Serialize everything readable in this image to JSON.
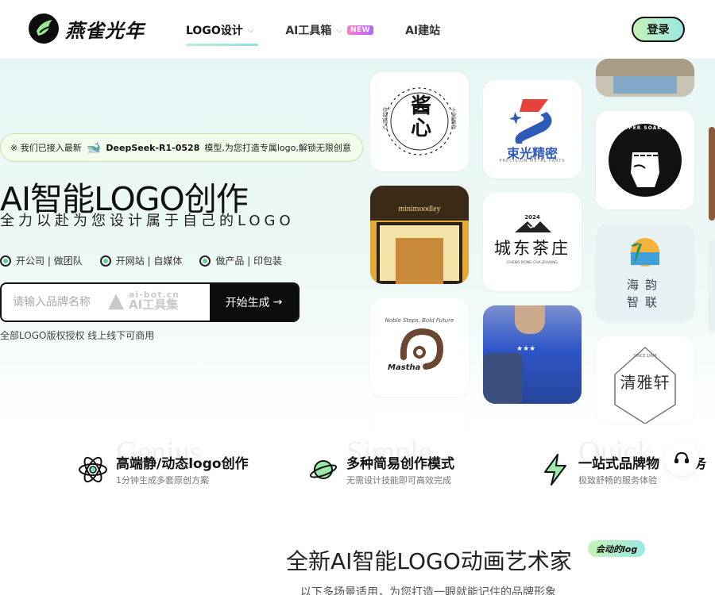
{
  "brand": {
    "name": "燕雀光年"
  },
  "nav": {
    "items": [
      {
        "label": "LOGO设计",
        "active": true,
        "has_dropdown": true
      },
      {
        "label": "AI工具箱",
        "has_dropdown": true,
        "badge": "NEW"
      },
      {
        "label": "AI建站"
      }
    ],
    "login_label": "登录"
  },
  "hero": {
    "notice": {
      "prefix": "※ 我们已接入最新",
      "model": "DeepSeek-R1-0528",
      "suffix": "模型,为您打造专属logo,解锁无限创意"
    },
    "title": "AI智能LOGO创作",
    "subtitle": "全力以赴为您设计属于自己的LOGO",
    "features": [
      "开公司 | 做团队",
      "开网站 | 自媒体",
      "做产品 | 印包装"
    ],
    "search": {
      "placeholder": "请输入品牌名称",
      "button_label": "开始生成",
      "button_arrow": "→"
    },
    "watermark": {
      "url": "ai-bot.cn",
      "name": "AI工具集"
    },
    "copyright": "全部LOGO版权授权 线上线下可商用"
  },
  "logo_cards": [
    {
      "name": "酱心",
      "side_left": "佳味精心",
      "side_right": "十里飘香"
    },
    {
      "name": "束光精密",
      "tagline": "PRECISION METAL PARTS"
    },
    {
      "name": "SUPER SOAKER"
    },
    {
      "name": "minimoodley"
    },
    {
      "name": "城东茶庄",
      "year": "2024",
      "tagline": "CHENG DONG CHA ZHUANG"
    },
    {
      "name": "海韵智联"
    },
    {
      "name": "Mastha",
      "tagline": "Noble Steps, Bold Future"
    },
    {
      "name": "清雅轩",
      "tagline": "SINCE 1998"
    }
  ],
  "highlights": [
    {
      "title": "高端静/动态logo创作",
      "desc": "1分钟生成多套原创方案",
      "icon": "atom-icon",
      "ghost": "Genius"
    },
    {
      "title": "多种简易创作模式",
      "desc": "无需设计技能即可高效完成",
      "icon": "planet-icon",
      "ghost": "Simple"
    },
    {
      "title": "一站式品牌物",
      "title_tail": "务",
      "desc": "极致舒畅的服务体验",
      "icon": "lightning-icon",
      "ghost": "Quick"
    }
  ],
  "section": {
    "title": "全新AI智能LOGO动画艺术家",
    "badge": "会动的log",
    "subtitle": "以下多场景适用，为您打造一眼就能记住的品牌形象"
  },
  "colors": {
    "accent_green": "#c4f3b5",
    "accent_teal": "#9be8e3",
    "primary": "#111111"
  }
}
